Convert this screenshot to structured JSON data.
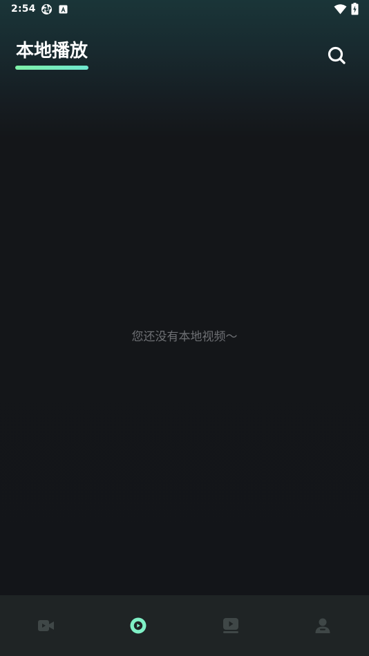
{
  "status_bar": {
    "time": "2:54",
    "left_icons": [
      "aperture-icon",
      "a-badge-icon"
    ],
    "right_icons": [
      "wifi-icon",
      "battery-icon"
    ]
  },
  "header": {
    "title": "本地播放",
    "search_icon": "search-icon"
  },
  "empty_state": {
    "message": "您还没有本地视频～"
  },
  "bottom_nav": {
    "items": [
      {
        "icon": "video-camera-icon",
        "active": false
      },
      {
        "icon": "play-circle-icon",
        "active": true
      },
      {
        "icon": "video-library-icon",
        "active": false
      },
      {
        "icon": "user-profile-icon",
        "active": false
      }
    ]
  },
  "colors": {
    "accent": "#7ff0c6",
    "background": "#131519",
    "header_top": "#1a3538",
    "nav_background": "#1f2425",
    "nav_inactive": "#3f4747",
    "empty_text": "#6e7074"
  }
}
